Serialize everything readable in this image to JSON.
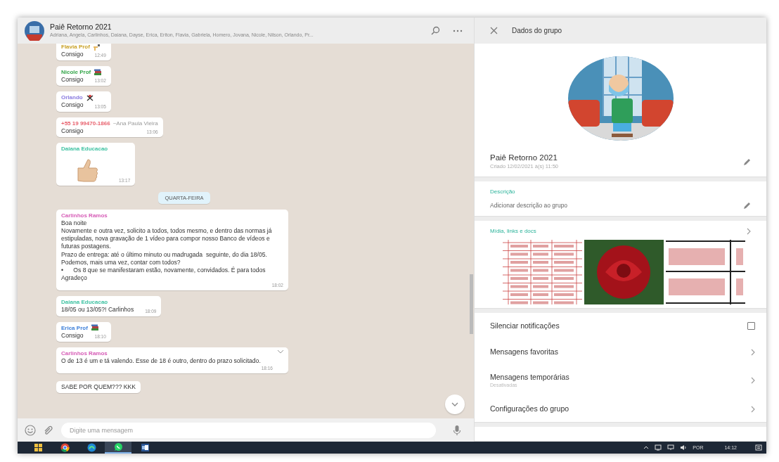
{
  "chat": {
    "title": "Paiê Retorno 2021",
    "participants": "Adriana, Angela, Carlinhos, Daiana, Dayse, Erica, Eriton, Flavia, Gabriela, Homero, Jovana, Nicole, Nilson, Orlando, Pr...",
    "messages": [
      {
        "kind": "text",
        "sender": "Flavia Prof",
        "color": "#c9a227",
        "hand_icon": true,
        "text": "Consigo",
        "time": "12:49"
      },
      {
        "kind": "text",
        "sender": "Nicole Prof",
        "color": "#35a64a",
        "books_icon": true,
        "text": "Consigo",
        "time": "13:02"
      },
      {
        "kind": "text",
        "sender": "Orlando",
        "color": "#8a7be0",
        "figure_icon": true,
        "text": "Consigo",
        "time": "13:05"
      },
      {
        "kind": "text",
        "sender": "+55 19 99470-1866",
        "color": "#e8616d",
        "push_name": "~Ana Paula Vieira",
        "text": "Consigo",
        "time": "13:06"
      },
      {
        "kind": "sticker",
        "sender": "Daiana Educacao",
        "color": "#3fc2a2",
        "time": "13:17"
      },
      {
        "kind": "date",
        "text": "QUARTA-FEIRA"
      },
      {
        "kind": "text",
        "sender": "Carlinhos Ramos",
        "color": "#d65bb6",
        "text": "Boa noite\nNovamente e outra vez, solicito a todos, todos mesmo, e dentro das normas já estipuladas, nova gravação de 1 vídeo para compor nosso Banco de vídeos e futuras postagens.\nPrazo de entrega: até o último minuto ou madrugada  seguinte, do dia 18/05.\nPodemos, mais uma vez, contar com todos?\n•      Os 8 que se manifestaram estão, novamente, convidados. É para todos\nAgradeço",
        "time": "18:02"
      },
      {
        "kind": "text",
        "sender": "Daiana Educacao",
        "color": "#3fc2a2",
        "text": "18/05 ou 13/05?! Carlinhos",
        "time": "18:09"
      },
      {
        "kind": "text",
        "sender": "Erica Prof",
        "color": "#3d7fd9",
        "books_icon": true,
        "text": "Consigo",
        "time": "18:10"
      },
      {
        "kind": "text",
        "sender": "Carlinhos Ramos",
        "color": "#d65bb6",
        "hovered": true,
        "text": "O de 13 é um e tá valendo. Esse de 18 é outro, dentro do prazo solicitado.",
        "time": "18:16"
      },
      {
        "kind": "text",
        "text": "SABE POR QUEM??? KKK"
      }
    ]
  },
  "composer": {
    "placeholder": "Digite uma mensagem"
  },
  "info_panel": {
    "title": "Dados do grupo",
    "group_name": "Paiê Retorno 2021",
    "created": "Criado 12/02/2021 à(s) 11:50",
    "description_label": "Descrição",
    "description_placeholder": "Adicionar descrição ao grupo",
    "media_label": "Mídia, links e docs",
    "media": [
      {
        "kind": "document"
      },
      {
        "kind": "photo"
      },
      {
        "kind": "document_zoomed"
      }
    ],
    "options": [
      {
        "kind": "checkbox",
        "label": "Silenciar notificações",
        "checked": false
      },
      {
        "kind": "link",
        "label": "Mensagens favoritas"
      },
      {
        "kind": "link",
        "label": "Mensagens temporárias",
        "sublabel": "Desativadas"
      },
      {
        "kind": "link",
        "label": "Configurações do grupo"
      }
    ]
  },
  "taskbar": {
    "apps": [
      {
        "kind": "start",
        "selected": false
      },
      {
        "kind": "browser",
        "selected": false
      },
      {
        "kind": "edge",
        "selected": false
      },
      {
        "kind": "chat",
        "selected": true
      },
      {
        "kind": "word",
        "selected": false
      }
    ],
    "language": "POR",
    "time": "14:12"
  }
}
